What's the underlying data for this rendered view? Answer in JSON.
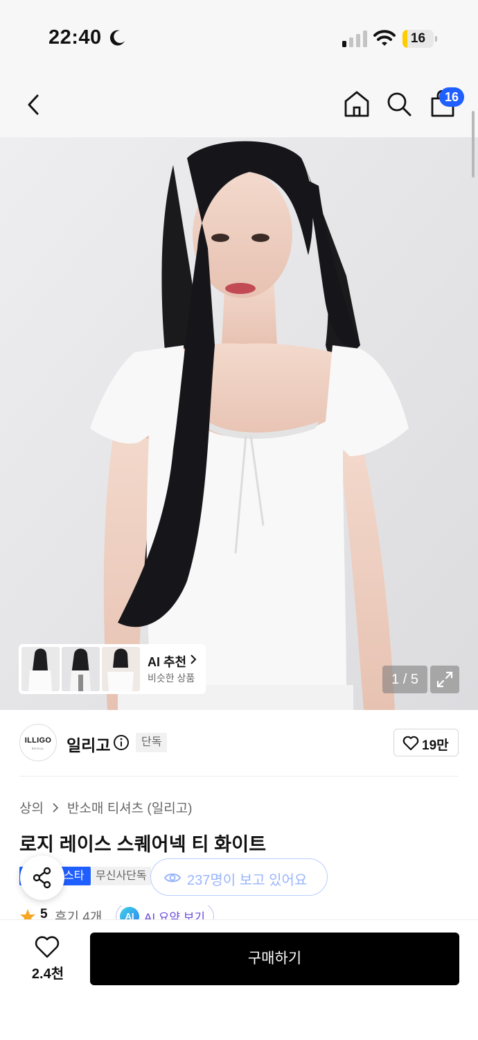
{
  "status_bar": {
    "time": "22:40",
    "battery_level": "16",
    "icons": [
      "moon-icon",
      "signal-icon",
      "wifi-icon",
      "battery-icon"
    ]
  },
  "nav": {
    "icons": [
      "back-icon",
      "home-icon",
      "search-icon",
      "shopping-bag-icon"
    ],
    "cart_badge": "16",
    "accent_color": "#1f5eff"
  },
  "gallery": {
    "ai_recommend": {
      "title": "AI 추천",
      "subtitle": "비슷한 상품"
    },
    "counter": "1 / 5"
  },
  "brand": {
    "logo_text": "ILLIGO",
    "logo_subtext": "SEOUL",
    "name": "일리고",
    "tag": "단독",
    "likes": "19만"
  },
  "product": {
    "breadcrumb": [
      "상의",
      "반소매 티셔츠 (일리고)"
    ],
    "title": "로지 레이스 스퀘어넥 티 화이트",
    "badge_blue": "스타",
    "badge_gray": "무신사단독",
    "viewers": "237명이 보고 있어요",
    "rating": "5",
    "reviews": "후기 4개",
    "ai_summary_badge": "AI",
    "ai_summary_label": "AI 요약 보기"
  },
  "bottom": {
    "wishlist_count": "2.4천",
    "buy_label": "구매하기"
  }
}
